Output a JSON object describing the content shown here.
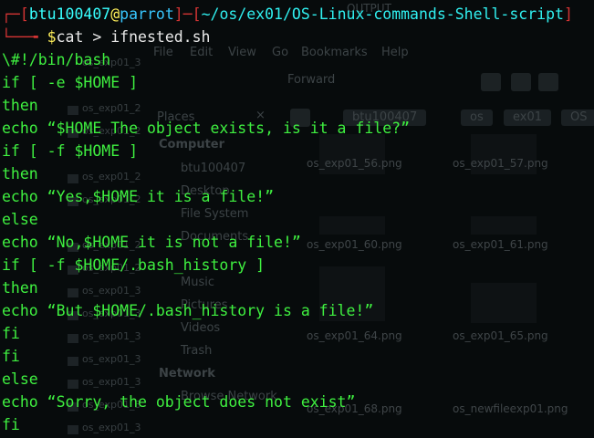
{
  "file_manager": {
    "title": "OUTPUT",
    "menu": [
      "File",
      "Edit",
      "View",
      "Go",
      "Bookmarks",
      "Help"
    ],
    "forward": "Forward",
    "path_buttons": [
      "btu100407",
      "os",
      "ex01",
      "OS"
    ],
    "places_header": "Places",
    "close_symbol": "×",
    "sidebar": {
      "computer_header": "Computer",
      "computer_items": [
        "btu100407",
        "Desktop",
        "File System",
        "Documents",
        "Music",
        "Pictures",
        "Videos",
        "Trash"
      ],
      "network_header": "Network",
      "network_items": [
        "Browse Network"
      ]
    },
    "files": [
      "os_exp01_56.png",
      "os_exp01_57.png",
      "os_exp01_60.png",
      "os_exp01_61.png",
      "os_exp01_64.png",
      "os_exp01_65.png",
      "os_exp01_68.png",
      "os_newfileexp01.png"
    ],
    "list_column": [
      "os_exp01_2",
      "os_exp01_2",
      "os_exp01_2",
      "os_exp01_2",
      "os_exp01_2",
      "os_exp01_2",
      "os_exp01_3",
      "os_exp01_3",
      "os_exp01_3",
      "os_exp01_3",
      "os_exp01_3",
      "os_exp01_3",
      "os_exp01_3",
      "os_exp01_3"
    ]
  },
  "terminal": {
    "prompt": {
      "open": "┌─[",
      "user": "btu100407",
      "at": "@",
      "host": "parrot",
      "sep": "]─[",
      "path": "~/os/ex01/OS-Linux-commands-Shell-script",
      "close": "]",
      "arrow": "└──╼ ",
      "dollar": "$",
      "command": "cat > ifnested.sh"
    },
    "script_lines": [
      "\\#!/bin/bash",
      "if [ -e $HOME ]",
      "then",
      "echo “$HOME The object exists, is it a file?”",
      "if [ -f $HOME ]",
      "then",
      "echo “Yes,$HOME it is a file!”",
      "else",
      "echo “No,$HOME it is not a file!”",
      "if [ -f $HOME/.bash_history ]",
      "then",
      "echo “But $HOME/.bash_history is a file!”",
      "fi",
      "fi",
      "else",
      "echo “Sorry, the object does not exist”",
      "fi"
    ]
  }
}
